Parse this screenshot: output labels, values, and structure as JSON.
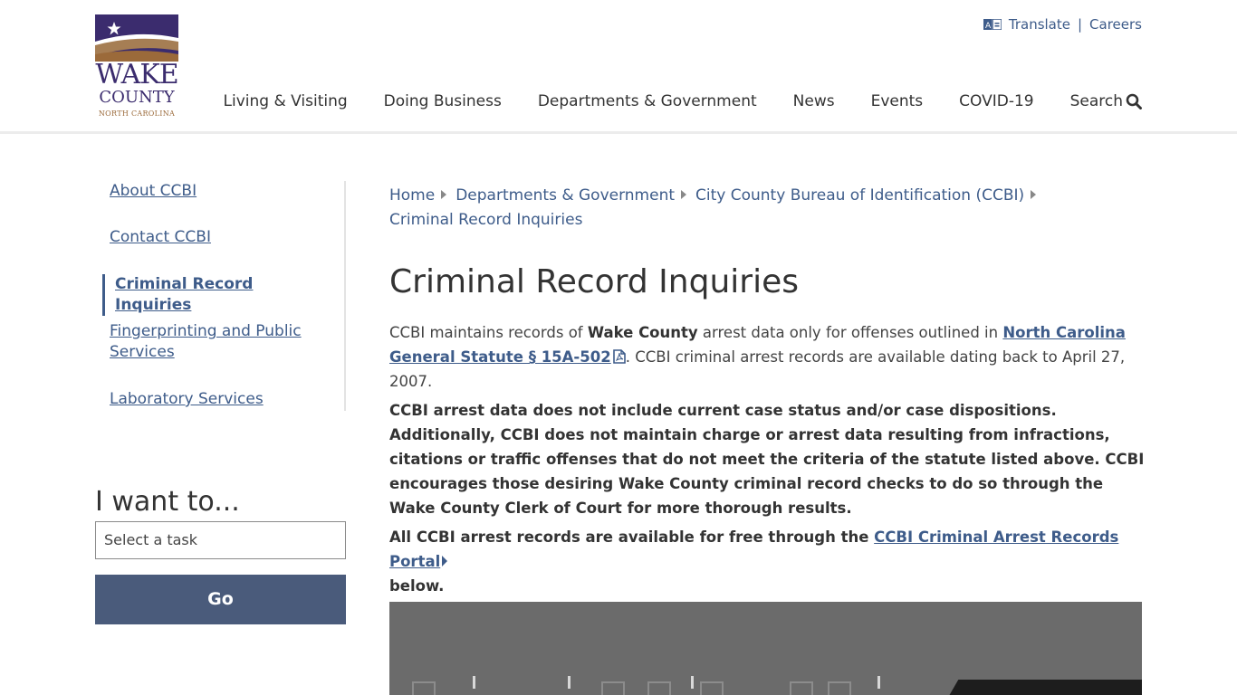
{
  "header": {
    "logo": {
      "line1": "WAKE",
      "line2": "COUNTY",
      "line3": "NORTH CAROLINA"
    },
    "utility": {
      "translate_label": "Translate",
      "separator": "|",
      "careers_label": "Careers"
    },
    "nav": [
      {
        "label": "Living & Visiting"
      },
      {
        "label": "Doing Business"
      },
      {
        "label": "Departments & Government"
      },
      {
        "label": "News"
      },
      {
        "label": "Events"
      },
      {
        "label": "COVID-19"
      }
    ],
    "search_label": "Search"
  },
  "sidebar": {
    "items": [
      {
        "label": "About CCBI"
      },
      {
        "label": "Contact CCBI"
      },
      {
        "label": "Criminal Record Inquiries",
        "active": true
      },
      {
        "label": "Fingerprinting and Public Services"
      },
      {
        "label": "Laboratory Services"
      }
    ],
    "iwant_title": "I want to...",
    "task_placeholder": "Select a task",
    "go_label": "Go"
  },
  "breadcrumb": {
    "items": [
      {
        "label": "Home"
      },
      {
        "label": "Departments & Government"
      },
      {
        "label": "City County Bureau of Identification (CCBI)"
      }
    ],
    "current": "Criminal Record Inquiries"
  },
  "main": {
    "title": "Criminal Record Inquiries",
    "p1": {
      "text_a": "CCBI maintains records of ",
      "bold": "Wake County",
      "text_b": " arrest data only for offenses outlined in ",
      "link": "North Carolina General Statute § 15A-502",
      "text_c": ".  CCBI criminal arrest records are available dating back to April 27, 2007."
    },
    "p2": "CCBI arrest data does not include current case status and/or case dispositions.  Additionally, CCBI does not maintain charge or arrest data resulting from infractions, citations or traffic offenses that do not meet the criteria of the statute listed above. CCBI encourages those desiring Wake County criminal record checks to do so through the Wake County Clerk of Court for more thorough results.",
    "p3": {
      "text_a": "All CCBI arrest records are available for free through the ",
      "link": "CCBI Criminal Arrest Records Portal",
      "text_b": " below."
    }
  },
  "colors": {
    "link": "#3e5c8a",
    "go_button": "#4a5b7b",
    "logo_purple": "#3b2c6e",
    "logo_brown": "#9b6a3a",
    "video_bg": "#6b6b6b"
  }
}
